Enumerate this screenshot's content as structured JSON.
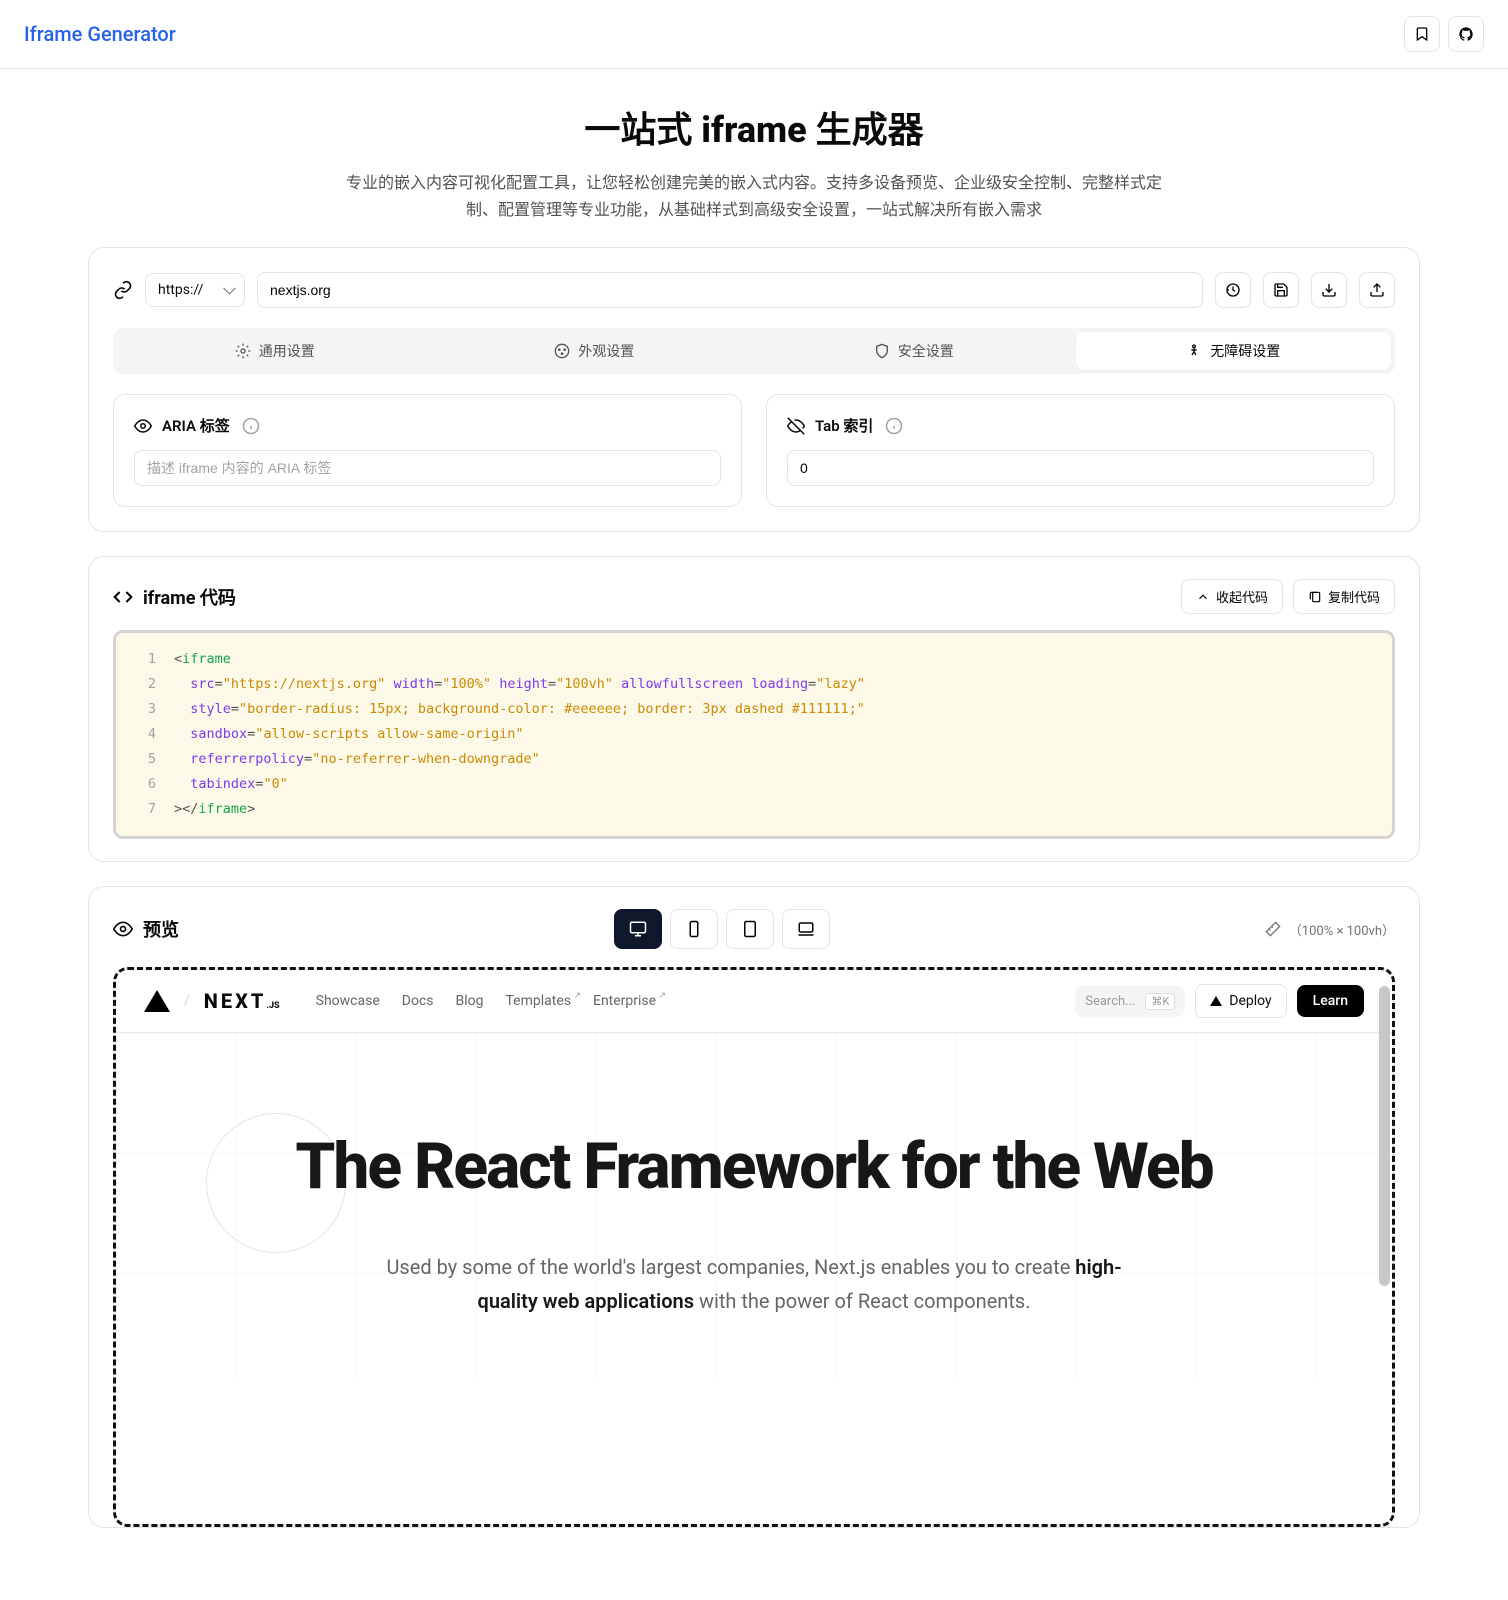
{
  "header": {
    "brand": "Iframe Generator"
  },
  "hero": {
    "title": "一站式 iframe 生成器",
    "desc": "专业的嵌入内容可视化配置工具，让您轻松创建完美的嵌入式内容。支持多设备预览、企业级安全控制、完整样式定制、配置管理等专业功能，从基础样式到高级安全设置，一站式解决所有嵌入需求"
  },
  "config": {
    "protocol": "https://",
    "url": "nextjs.org",
    "tabs": {
      "general": "通用设置",
      "appearance": "外观设置",
      "security": "安全设置",
      "a11y": "无障碍设置"
    },
    "aria": {
      "label": "ARIA 标签",
      "placeholder": "描述 iframe 内容的 ARIA 标签"
    },
    "tabindex": {
      "label": "Tab 索引",
      "value": "0"
    }
  },
  "code": {
    "title": "iframe 代码",
    "collapse": "收起代码",
    "copy": "复制代码",
    "l1_tag": "iframe",
    "l2_src_attr": "src",
    "l2_src_val": "\"https://nextjs.org\"",
    "l2_w_attr": "width",
    "l2_w_val": "\"100%\"",
    "l2_h_attr": "height",
    "l2_h_val": "\"100vh\"",
    "l2_af_attr": "allowfullscreen",
    "l2_ld_attr": "loading",
    "l2_ld_val": "\"lazy\"",
    "l3_attr": "style",
    "l3_val": "\"border-radius: 15px; background-color: #eeeeee; border: 3px dashed #111111;\"",
    "l4_attr": "sandbox",
    "l4_val": "\"allow-scripts allow-same-origin\"",
    "l5_attr": "referrerpolicy",
    "l5_val": "\"no-referrer-when-downgrade\"",
    "l6_attr": "tabindex",
    "l6_val": "\"0\"",
    "l7_tag": "iframe",
    "ln1": "1",
    "ln2": "2",
    "ln3": "3",
    "ln4": "4",
    "ln5": "5",
    "ln6": "6",
    "ln7": "7"
  },
  "preview": {
    "title": "预览",
    "dims": "（100% × 100vh）",
    "next": {
      "brand": "NEXT",
      "brand_suffix": ".JS",
      "nav": {
        "showcase": "Showcase",
        "docs": "Docs",
        "blog": "Blog",
        "templates": "Templates",
        "enterprise": "Enterprise"
      },
      "search": "Search...",
      "kbd": "⌘K",
      "deploy": "Deploy",
      "learn": "Learn",
      "hero_title": "The React Framework for the Web",
      "hero_sub_1": "Used by some of the world's largest companies, Next.js enables you to create ",
      "hero_sub_b": "high-quality web applications",
      "hero_sub_2": " with the power of React components."
    }
  }
}
